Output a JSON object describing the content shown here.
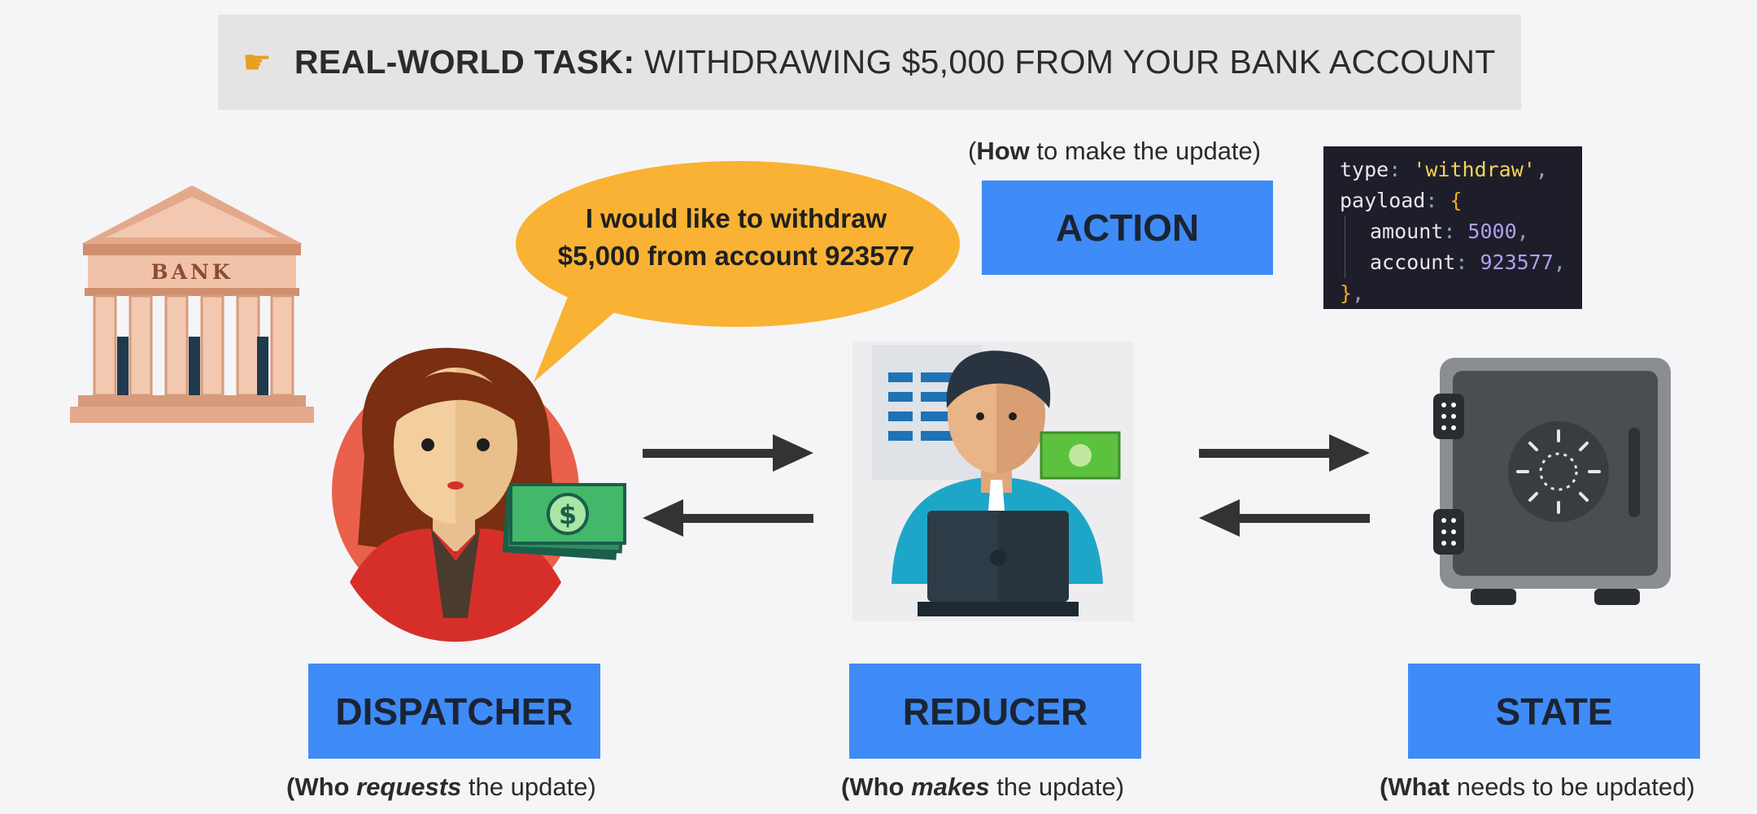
{
  "header": {
    "icon": "pointing-hand-icon",
    "title_bold": "REAL-WORLD TASK:",
    "title_rest": " WITHDRAWING $5,000 FROM YOUR BANK ACCOUNT"
  },
  "bank_sign": "BANK",
  "speech_bubble": {
    "line1": "I would like to withdraw",
    "line2": "$5,000 from account 923577"
  },
  "action": {
    "caption_bold": "How",
    "caption_rest": " to make the update)",
    "caption_open": "(",
    "label": "ACTION"
  },
  "code": {
    "type_key": "type",
    "type_value": "'withdraw'",
    "payload_key": "payload",
    "amount_key": "amount",
    "amount_value": "5000",
    "account_key": "account",
    "account_value": "923577"
  },
  "dispatcher": {
    "label": "DISPATCHER",
    "caption_open": "(Who ",
    "caption_em": "requests",
    "caption_rest": " the update)"
  },
  "reducer": {
    "label": "REDUCER",
    "caption_open": "(Who ",
    "caption_em": "makes",
    "caption_rest": " the update)"
  },
  "state": {
    "label": "STATE",
    "caption_open": "(",
    "caption_bold": "What",
    "caption_rest": " needs to be updated)"
  },
  "colors": {
    "label_bg": "#3f8bf7",
    "bubble": "#f9b233",
    "title_bg": "#e4e4e4",
    "code_bg": "#1e1e2a"
  }
}
